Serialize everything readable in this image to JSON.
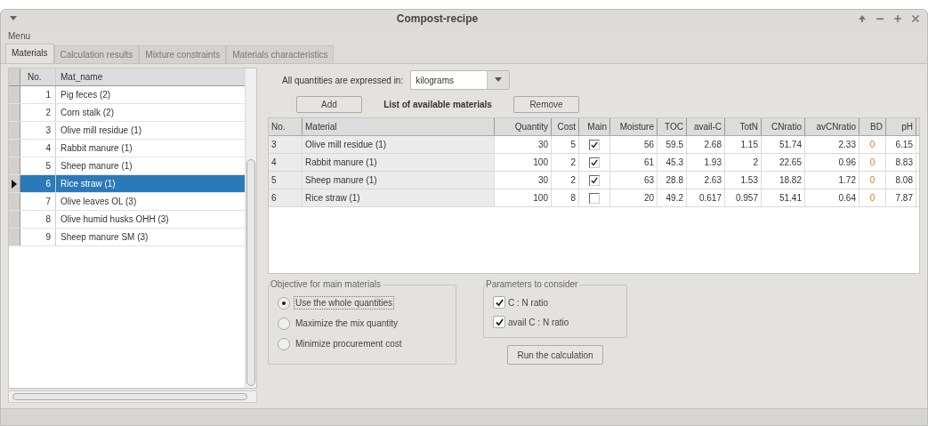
{
  "window": {
    "title": "Compost-recipe"
  },
  "menu": [
    "Menu"
  ],
  "tabs": [
    {
      "label": "Materials",
      "selected": true
    },
    {
      "label": "Calculation results",
      "selected": false
    },
    {
      "label": "Mixture constraints",
      "selected": false
    },
    {
      "label": "Materials characteristics",
      "selected": false
    }
  ],
  "mat_list": {
    "columns": [
      "No.",
      "Mat_name"
    ],
    "rows": [
      {
        "no": "1",
        "name": "Pig feces (2)",
        "selected": false
      },
      {
        "no": "2",
        "name": "Corn stalk (2)",
        "selected": false
      },
      {
        "no": "3",
        "name": "Olive mill residue (1)",
        "selected": false
      },
      {
        "no": "4",
        "name": "Rabbit manure (1)",
        "selected": false
      },
      {
        "no": "5",
        "name": "Sheep manure (1)",
        "selected": false
      },
      {
        "no": "6",
        "name": "Rice straw (1)",
        "selected": true
      },
      {
        "no": "7",
        "name": "Olive leaves OL (3)",
        "selected": false
      },
      {
        "no": "8",
        "name": "Olive humid husks OHH (3)",
        "selected": false
      },
      {
        "no": "9",
        "name": "Sheep manure SM (3)",
        "selected": false
      }
    ]
  },
  "units": {
    "label": "All quantities are expressed in:",
    "value": "kilograms"
  },
  "add_button": "Add",
  "list_title": "List of available materials",
  "remove_button": "Remove",
  "materials_table": {
    "columns": [
      "No.",
      "Material",
      "Quantity",
      "Cost",
      "Main",
      "Moisture",
      "TOC",
      "avail-C",
      "TotN",
      "CNratio",
      "avCNratio",
      "BD",
      "pH"
    ],
    "rows": [
      {
        "values": [
          "3",
          "Olive mill residue (1)",
          "30",
          "5",
          "56",
          "59.5",
          "2.68",
          "1.15",
          "51.74",
          "2.33",
          "0",
          "6.15"
        ],
        "main": true
      },
      {
        "values": [
          "4",
          "Rabbit manure (1)",
          "100",
          "2",
          "61",
          "45.3",
          "1.93",
          "2",
          "22.65",
          "0.96",
          "0",
          "8.83"
        ],
        "main": true
      },
      {
        "values": [
          "5",
          "Sheep manure (1)",
          "30",
          "2",
          "63",
          "28.8",
          "2.63",
          "1.53",
          "18.82",
          "1.72",
          "0",
          "8.08"
        ],
        "main": true
      },
      {
        "values": [
          "6",
          "Rice straw (1)",
          "100",
          "8",
          "20",
          "49.2",
          "0.617",
          "0.957",
          "51.41",
          "0.64",
          "0",
          "7.87"
        ],
        "main": false
      }
    ]
  },
  "objective": {
    "title": "Objective for main materials",
    "options": [
      {
        "label": "Use the whole quantities",
        "selected": true,
        "focused": true
      },
      {
        "label": "Maximize the mix quantity",
        "selected": false,
        "focused": false
      },
      {
        "label": "Minimize procurement cost",
        "selected": false,
        "focused": false
      }
    ]
  },
  "parameters": {
    "title": "Parameters to consider",
    "options": [
      {
        "label": "C : N ratio",
        "checked": true
      },
      {
        "label": "avail C : N ratio",
        "checked": true
      }
    ]
  },
  "run_button": "Run the calculation"
}
